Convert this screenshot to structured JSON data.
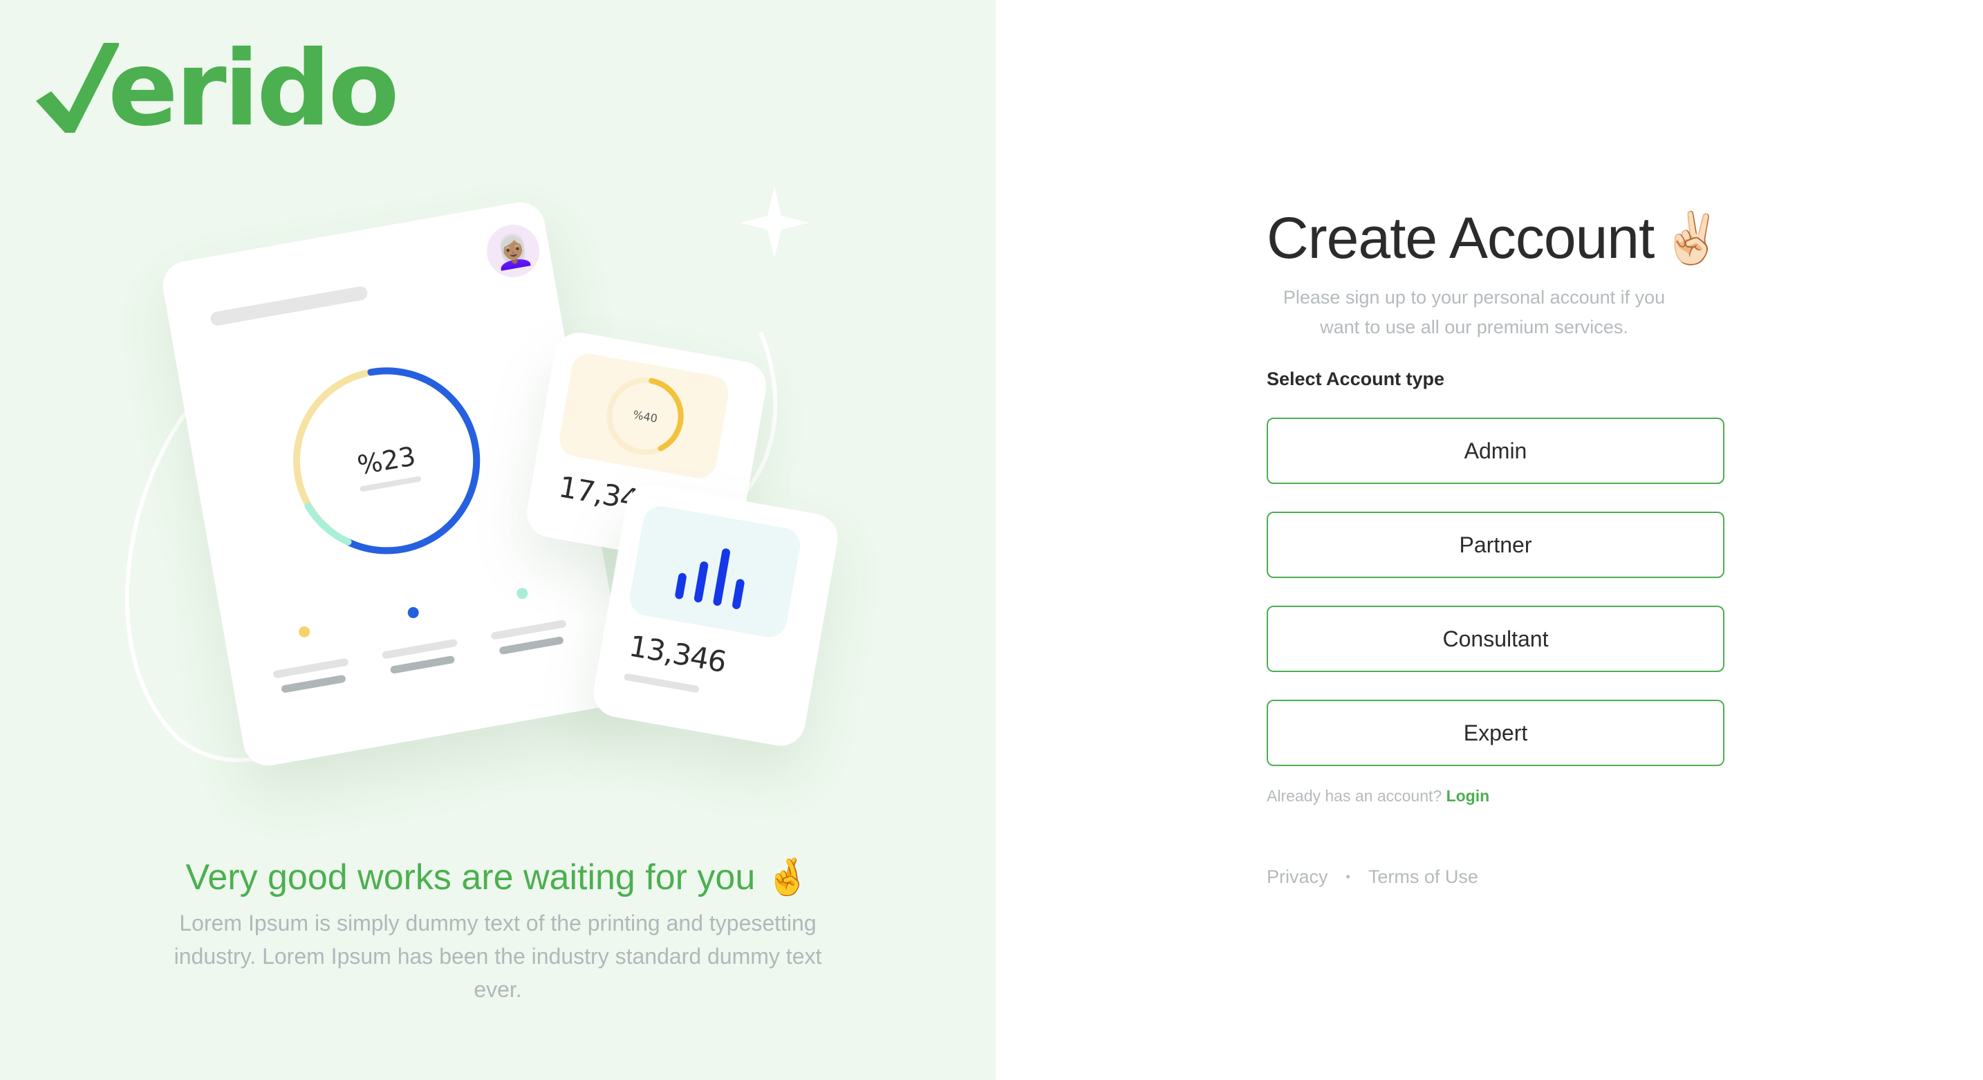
{
  "brand": {
    "name": "erido",
    "accent": "#4caf50",
    "panel_bg": "#eef8ee"
  },
  "illustration": {
    "main_ring_label": "%23",
    "main_ring_progress": 0.23,
    "small_ring_label": "%40",
    "small_ring_progress": 0.4,
    "mid_card_number": "17,346",
    "front_card_number": "13,346",
    "avatar_icon": "woman-avatar-icon",
    "chart_icon": "bar-chart-icon"
  },
  "tagline": {
    "title": "Very good works are waiting for you",
    "title_emoji": "🤞",
    "text": "Lorem Ipsum is simply dummy text of the printing and typesetting industry. Lorem Ipsum has been the industry standard dummy text ever."
  },
  "form": {
    "title": "Create Account",
    "title_emoji": "✌🏻",
    "subtitle": "Please sign up to your personal account if you want to use all our premium services.",
    "account_type_label": "Select Account type",
    "account_types": [
      "Admin",
      "Partner",
      "Consultant",
      "Expert"
    ],
    "login_prompt": "Already has an account?",
    "login_link": "Login"
  },
  "footer": {
    "privacy": "Privacy",
    "separator": "•",
    "terms": "Terms of Use"
  }
}
